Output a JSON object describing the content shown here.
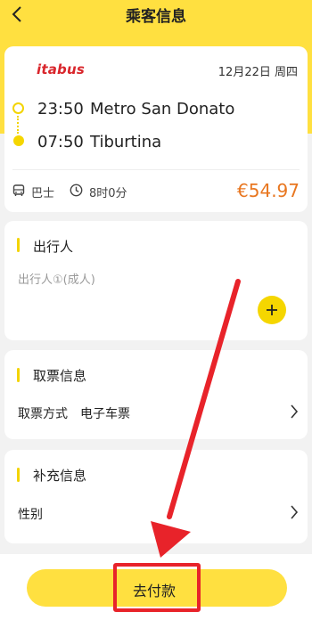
{
  "header": {
    "title": "乘客信息"
  },
  "trip": {
    "operator": "itabus",
    "date": "12月22日 周四",
    "departure": {
      "time": "23:50",
      "station": "Metro San Donato"
    },
    "arrival": {
      "time": "07:50",
      "station": "Tiburtina"
    },
    "vehicle": "巴士",
    "duration": "8时0分",
    "price": "€54.97"
  },
  "passenger_section": {
    "title": "出行人",
    "slot": "出行人①(成人)"
  },
  "ticket_section": {
    "title": "取票信息",
    "method_label": "取票方式",
    "method_value": "电子车票"
  },
  "extra_section": {
    "title": "补充信息",
    "gender_label": "性别"
  },
  "footer": {
    "pay_label": "去付款"
  },
  "colors": {
    "accent": "#ffe040",
    "price": "#e8761f",
    "annotation": "#e8232a"
  },
  "icons": [
    "back-arrow-icon",
    "bus-icon",
    "clock-icon",
    "plus-icon",
    "chevron-right-icon",
    "annotation-arrow"
  ]
}
